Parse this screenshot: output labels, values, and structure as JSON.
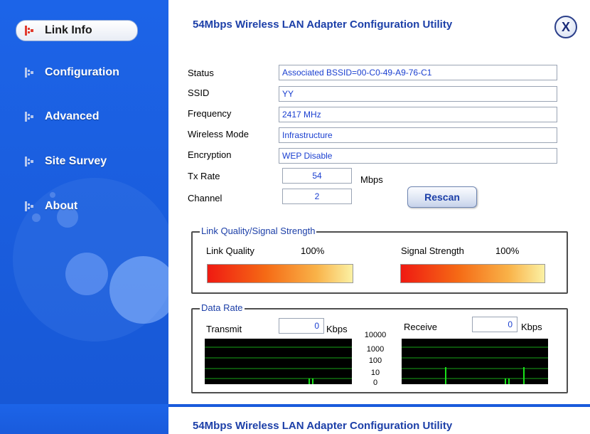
{
  "app": {
    "title": "54Mbps Wireless LAN Adapter Configuration Utility",
    "close_label": "X"
  },
  "sidebar": {
    "items": [
      {
        "label": "Link Info",
        "active": true
      },
      {
        "label": "Configuration",
        "active": false
      },
      {
        "label": "Advanced",
        "active": false
      },
      {
        "label": "Site Survey",
        "active": false
      },
      {
        "label": "About",
        "active": false
      }
    ]
  },
  "link_info": {
    "status_label": "Status",
    "status_value": "Associated BSSID=00-C0-49-A9-76-C1",
    "ssid_label": "SSID",
    "ssid_value": "YY",
    "frequency_label": "Frequency",
    "frequency_value": "2417 MHz",
    "wireless_mode_label": "Wireless Mode",
    "wireless_mode_value": "Infrastructure",
    "encryption_label": "Encryption",
    "encryption_value": "WEP Disable",
    "tx_rate_label": "Tx Rate",
    "tx_rate_value": "54",
    "tx_rate_unit": "Mbps",
    "channel_label": "Channel",
    "channel_value": "2",
    "rescan_label": "Rescan"
  },
  "signal": {
    "group_title": "Link Quality/Signal Strength",
    "link_quality_label": "Link Quality",
    "link_quality_value": "100%",
    "link_quality_fraction": 1.0,
    "signal_strength_label": "Signal Strength",
    "signal_strength_value": "100%",
    "signal_strength_fraction": 1.0
  },
  "data_rate": {
    "group_title": "Data Rate",
    "transmit_label": "Transmit",
    "transmit_value": "0",
    "transmit_unit": "Kbps",
    "receive_label": "Receive",
    "receive_value": "0",
    "receive_unit": "Kbps",
    "scale_labels": [
      "10000",
      "1000",
      "100",
      "10",
      "0"
    ]
  },
  "colors": {
    "accent": "#1c3fa8",
    "sidebar": "#1c64e8",
    "graph_line": "#19c919"
  },
  "icons": {
    "nav": "bars-icon",
    "close": "close-icon"
  }
}
